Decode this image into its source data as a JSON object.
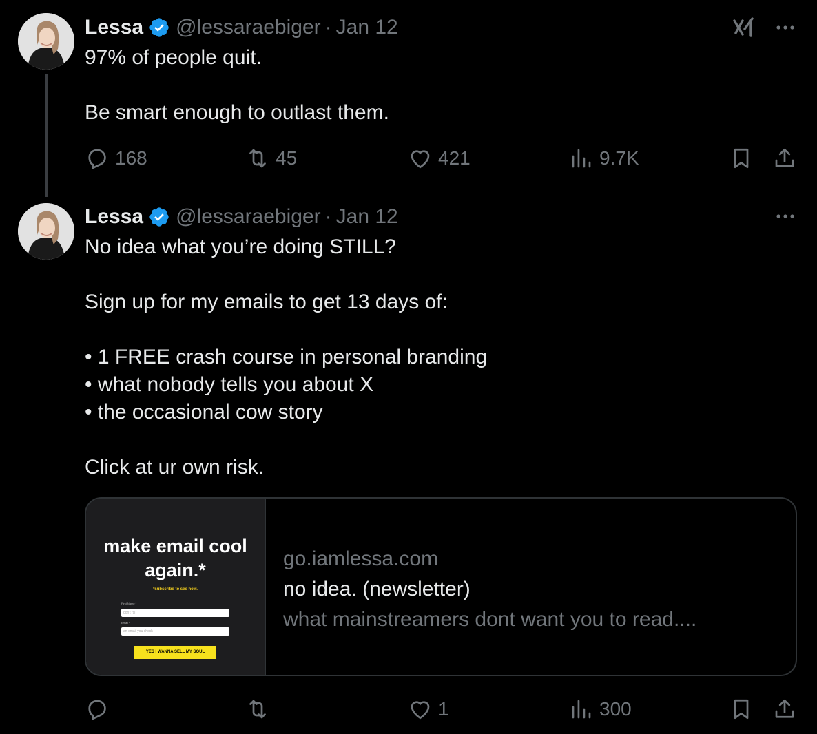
{
  "tweets": [
    {
      "author": "Lessa",
      "handle": "@lessaraebiger",
      "separator": "·",
      "date": "Jan 12",
      "text": "97% of people quit.\n\nBe smart enough to outlast them.",
      "stats": {
        "replies": "168",
        "retweets": "45",
        "likes": "421",
        "views": "9.7K"
      }
    },
    {
      "author": "Lessa",
      "handle": "@lessaraebiger",
      "separator": "·",
      "date": "Jan 12",
      "text": "No idea what you’re doing STILL?\n\nSign up for my emails to get 13 days of:\n\n• 1 FREE crash course in personal branding\n• what nobody tells you about X\n• the occasional cow story\n\nClick at ur own risk.",
      "stats": {
        "replies": "",
        "retweets": "",
        "likes": "1",
        "views": "300"
      },
      "card": {
        "thumb_title": "make email cool again.*",
        "thumb_subtitle": "*subscribe to see how.",
        "thumb_first_name_label": "First Name *",
        "thumb_first_name_placeholder": "don't rsi",
        "thumb_email_label": "Email *",
        "thumb_email_placeholder": "an email you check",
        "thumb_button": "YES I WANNA SELL MY SOUL",
        "domain": "go.iamlessa.com",
        "title": "no idea. (newsletter)",
        "description": "what mainstreamers dont want you to read...."
      }
    }
  ],
  "colors": {
    "background": "#000000",
    "text_primary": "#e7e9ea",
    "text_secondary": "#71767b",
    "verified_badge": "#1d9bf0",
    "border": "#2f3336"
  },
  "icons": [
    "grok-icon",
    "more-icon",
    "reply-icon",
    "retweet-icon",
    "like-icon",
    "views-icon",
    "bookmark-icon",
    "share-icon",
    "verified-badge-icon"
  ]
}
